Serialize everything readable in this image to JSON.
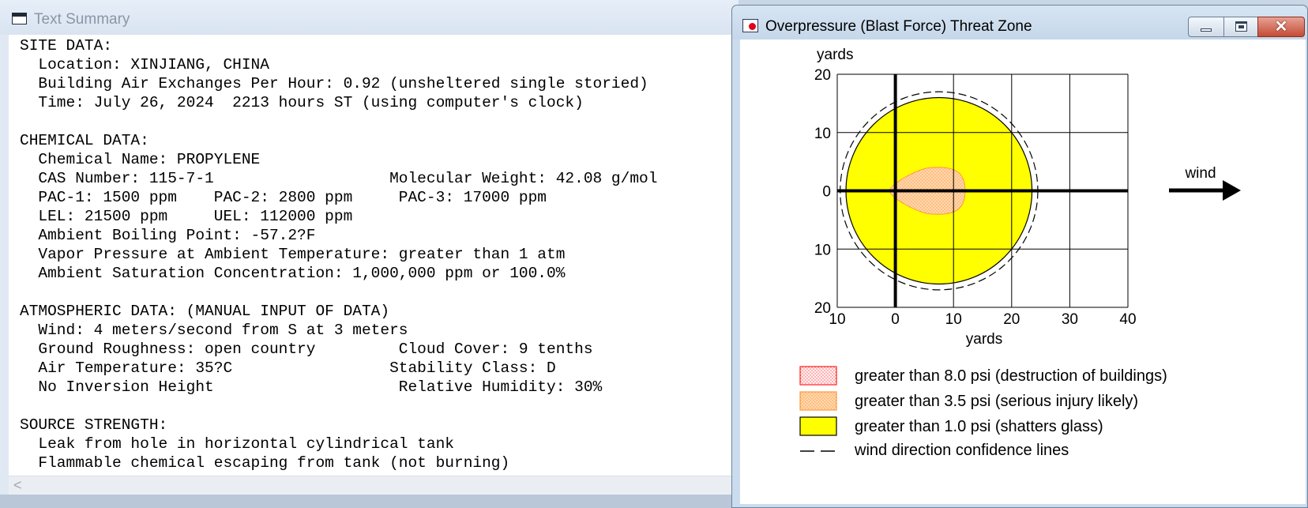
{
  "text_summary": {
    "title": "Text Summary",
    "scroll_left_glyph": "<",
    "lines": [
      "SITE DATA:",
      "  Location: XINJIANG, CHINA",
      "  Building Air Exchanges Per Hour: 0.92 (unsheltered single storied)",
      "  Time: July 26, 2024  2213 hours ST (using computer's clock)",
      "",
      "CHEMICAL DATA:",
      "  Chemical Name: PROPYLENE",
      "  CAS Number: 115-7-1                   Molecular Weight: 42.08 g/mol",
      "  PAC-1: 1500 ppm    PAC-2: 2800 ppm     PAC-3: 17000 ppm",
      "  LEL: 21500 ppm     UEL: 112000 ppm",
      "  Ambient Boiling Point: -57.2?F",
      "  Vapor Pressure at Ambient Temperature: greater than 1 atm",
      "  Ambient Saturation Concentration: 1,000,000 ppm or 100.0%",
      "",
      "ATMOSPHERIC DATA: (MANUAL INPUT OF DATA)",
      "  Wind: 4 meters/second from S at 3 meters",
      "  Ground Roughness: open country         Cloud Cover: 9 tenths",
      "  Air Temperature: 35?C                 Stability Class: D",
      "  No Inversion Height                    Relative Humidity: 30%",
      "",
      "SOURCE STRENGTH:",
      "  Leak from hole in horizontal cylindrical tank",
      "  Flammable chemical escaping from tank (not burning)"
    ]
  },
  "threat_zone": {
    "title": "Overpressure (Blast Force) Threat Zone",
    "close_glyph": "✕",
    "wind_label": "wind",
    "legend": [
      {
        "label": "greater than 8.0 psi (destruction of buildings)",
        "kind": "red-dotted"
      },
      {
        "label": "greater than 3.5 psi (serious injury likely)",
        "kind": "orange-dotted"
      },
      {
        "label": "greater than 1.0 psi (shatters glass)",
        "kind": "yellow"
      },
      {
        "label": "wind direction confidence lines",
        "kind": "dashed-line"
      }
    ],
    "colors": {
      "yellow_zone": "#ffff00",
      "orange_zone": "#ffd8b0",
      "orange_dots": "#ff9a3c",
      "red_zone": "#ffe6e6",
      "red_dots": "#ff2020"
    }
  },
  "chart_data": {
    "type": "threat-zone-map",
    "xlabel": "yards",
    "ylabel": "yards",
    "xlim": [
      -10,
      40
    ],
    "ylim": [
      -20,
      20
    ],
    "x_ticks": [
      "10",
      "0",
      "10",
      "20",
      "30",
      "40"
    ],
    "y_ticks": [
      "20",
      "10",
      "0",
      "10",
      "20"
    ],
    "zones": [
      {
        "name": "greater than 1.0 psi (shatters glass)",
        "center_x": 7.5,
        "center_y": 0,
        "radius": 16
      },
      {
        "name": "greater than 3.5 psi (serious injury likely)",
        "center_x": 7,
        "center_y": 0,
        "extent_x": [
          -1,
          12
        ],
        "extent_y": [
          -4,
          4
        ]
      }
    ],
    "confidence_lines": {
      "center_x": 7.5,
      "center_y": 0,
      "radius": 17
    },
    "grid": true
  }
}
